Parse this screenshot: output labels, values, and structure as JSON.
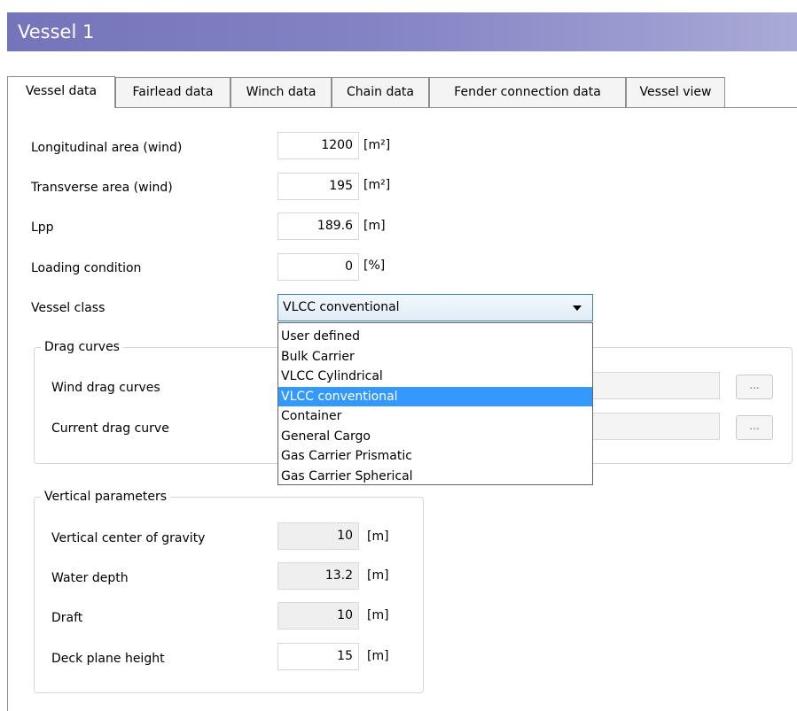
{
  "window": {
    "title": "Vessel 1"
  },
  "tabs": [
    {
      "label": "Vessel data",
      "active": true
    },
    {
      "label": "Fairlead data"
    },
    {
      "label": "Winch data"
    },
    {
      "label": "Chain data"
    },
    {
      "label": "Fender connection data"
    },
    {
      "label": "Vessel view"
    }
  ],
  "fields": {
    "long_area": {
      "label": "Longitudinal area (wind)",
      "value": "1200",
      "unit": "[m²]"
    },
    "trans_area": {
      "label": "Transverse area (wind)",
      "value": "195",
      "unit": "[m²]"
    },
    "lpp": {
      "label": "Lpp",
      "value": "189.6",
      "unit": "[m]"
    },
    "loading": {
      "label": "Loading condition",
      "value": "0",
      "unit": "[%]"
    }
  },
  "vessel_class": {
    "label": "Vessel class",
    "selected": "VLCC conventional",
    "options": [
      "User defined",
      "Bulk Carrier",
      "VLCC Cylindrical",
      "VLCC conventional",
      "Container",
      "General Cargo",
      "Gas Carrier Prismatic",
      "Gas Carrier Spherical"
    ]
  },
  "drag_curves": {
    "title": "Drag curves",
    "wind_label": "Wind drag curves",
    "current_label": "Current drag curve",
    "browse_label": "..."
  },
  "vertical": {
    "title": "Vertical parameters",
    "vcg": {
      "label": "Vertical center of gravity",
      "value": "10",
      "unit": "[m]"
    },
    "water_depth": {
      "label": "Water depth",
      "value": "13.2",
      "unit": "[m]"
    },
    "draft": {
      "label": "Draft",
      "value": "10",
      "unit": "[m]"
    },
    "deck_height": {
      "label": "Deck plane height",
      "value": "15",
      "unit": "[m]"
    }
  },
  "colors": {
    "title_gradient_start": "#7574ba",
    "title_gradient_end": "#aaaad6",
    "selection": "#3399ff"
  }
}
